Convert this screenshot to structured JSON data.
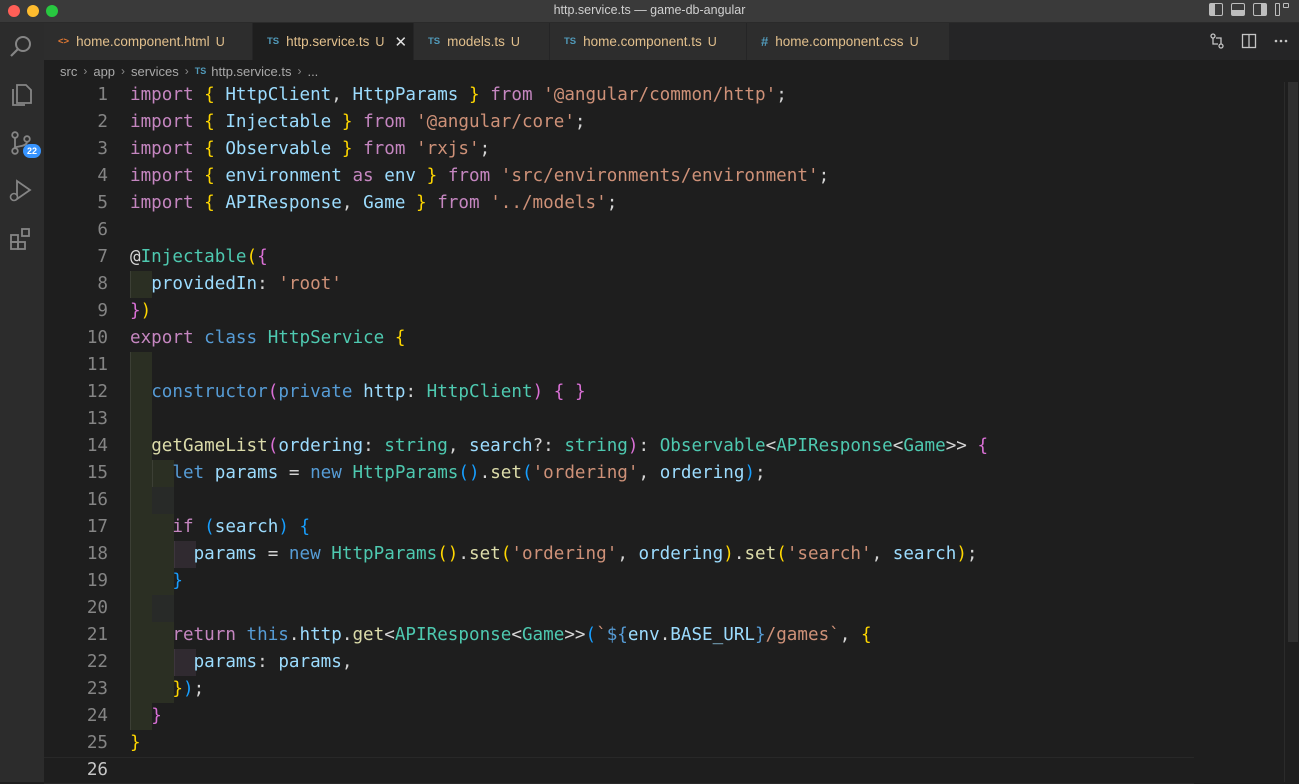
{
  "window": {
    "title": "http.service.ts — game-db-angular"
  },
  "activity": {
    "items": [
      {
        "name": "search-icon"
      },
      {
        "name": "explorer-icon"
      },
      {
        "name": "source-control-icon",
        "badge": "22"
      },
      {
        "name": "run-debug-icon"
      },
      {
        "name": "extensions-icon"
      }
    ]
  },
  "tabs": [
    {
      "icon": "<>",
      "label": "home.component.html",
      "status": "U",
      "active": false
    },
    {
      "icon": "TS",
      "label": "http.service.ts",
      "status": "U",
      "active": true,
      "close": "✕"
    },
    {
      "icon": "TS",
      "label": "models.ts",
      "status": "U",
      "active": false
    },
    {
      "icon": "TS",
      "label": "home.component.ts",
      "status": "U",
      "active": false
    },
    {
      "icon": "#",
      "label": "home.component.css",
      "status": "U",
      "active": false
    }
  ],
  "breadcrumb": [
    "src",
    "app",
    "services",
    "http.service.ts",
    "..."
  ],
  "breadcrumb_file_icon": "TS",
  "editor": {
    "line_numbers": [
      "1",
      "2",
      "3",
      "4",
      "5",
      "6",
      "7",
      "8",
      "9",
      "10",
      "11",
      "12",
      "13",
      "14",
      "15",
      "16",
      "17",
      "18",
      "19",
      "20",
      "21",
      "22",
      "23",
      "24",
      "25",
      "26"
    ],
    "current_line": "26"
  },
  "colors": {
    "keyword_control": "#c586c0",
    "keyword": "#569cd6",
    "variable": "#9cdcfe",
    "type": "#4ec9b0",
    "function": "#dcdcaa",
    "string": "#ce9178",
    "bracket_1": "#ffd700",
    "bracket_2": "#da70d6",
    "bracket_3": "#179fff"
  }
}
